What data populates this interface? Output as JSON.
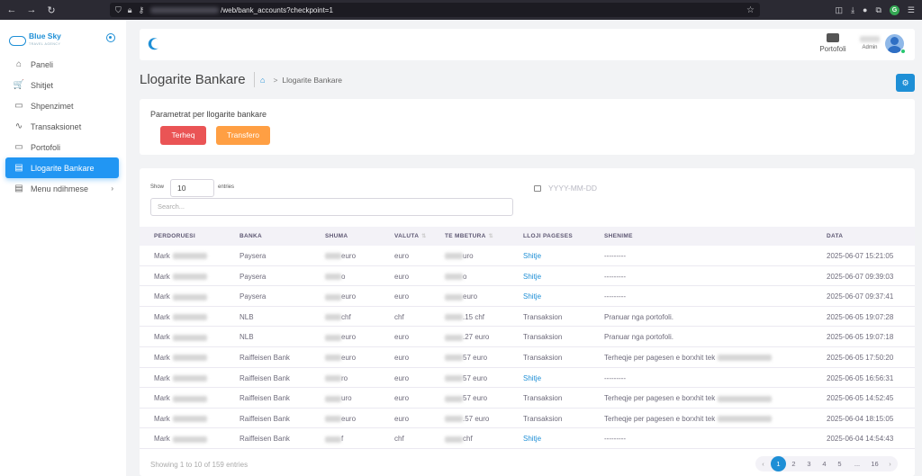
{
  "browser": {
    "url_suffix": "/web/bank_accounts?checkpoint=1",
    "nav": {
      "back": "←",
      "forward": "→",
      "reload": "↻"
    },
    "icons": [
      "shield-icon",
      "lock-icon",
      "key-icon",
      "pocket-icon",
      "download-icon",
      "extension-icon",
      "puzzle-icon",
      "grammarly-icon"
    ]
  },
  "brand": {
    "name": "Blue Sky",
    "tagline": "TRAVEL AGENCY",
    "color": "#1e8fd6"
  },
  "sidebar": {
    "items": [
      {
        "label": "Paneli",
        "icon": "home-icon",
        "glyph": "⌂"
      },
      {
        "label": "Shitjet",
        "icon": "cart-icon",
        "glyph": "🛒"
      },
      {
        "label": "Shpenzimet",
        "icon": "bag-icon",
        "glyph": "▭"
      },
      {
        "label": "Transaksionet",
        "icon": "activity-icon",
        "glyph": "∿"
      },
      {
        "label": "Portofoli",
        "icon": "wallet-icon",
        "glyph": "▭"
      },
      {
        "label": "Llogarite Bankare",
        "icon": "inbox-icon",
        "glyph": "▤",
        "active": true
      },
      {
        "label": "Menu ndihmese",
        "icon": "file-icon",
        "glyph": "▤",
        "chevron": "›"
      }
    ]
  },
  "header": {
    "wallet_label": "Portofoli",
    "user_role": "Admin"
  },
  "page": {
    "title": "Llogarite Bankare",
    "breadcrumb_current": "Llogarite Bankare",
    "breadcrumb_sep": ">"
  },
  "params": {
    "title": "Parametrat per llogarite bankare",
    "withdraw_label": "Terheq",
    "transfer_label": "Transfero"
  },
  "table": {
    "show_label": "Show",
    "entries_value": "10",
    "entries_label": "entries",
    "search_placeholder": "Search...",
    "date_placeholder": "YYYY-MM-DD",
    "columns": [
      "PERDORUESI",
      "BANKA",
      "SHUMA",
      "VALUTA",
      "TE MBETURA",
      "LLOJI PAGESES",
      "SHENIME",
      "DATA"
    ],
    "rows": [
      {
        "user": "Mark",
        "bank": "Paysera",
        "amount_suffix": "euro",
        "currency": "euro",
        "remaining_suffix": "uro",
        "type": "Shitje",
        "type_link": true,
        "note": "---------",
        "note_blur": false,
        "date": "2025-06-07 15:21:05"
      },
      {
        "user": "Mark",
        "bank": "Paysera",
        "amount_suffix": "o",
        "currency": "euro",
        "remaining_suffix": "o",
        "type": "Shitje",
        "type_link": true,
        "note": "---------",
        "note_blur": false,
        "date": "2025-06-07 09:39:03"
      },
      {
        "user": "Mark",
        "bank": "Paysera",
        "amount_suffix": "euro",
        "currency": "euro",
        "remaining_suffix": "euro",
        "type": "Shitje",
        "type_link": true,
        "note": "---------",
        "note_blur": false,
        "date": "2025-06-07 09:37:41"
      },
      {
        "user": "Mark",
        "bank": "NLB",
        "amount_suffix": "chf",
        "currency": "chf",
        "remaining_suffix": ".15 chf",
        "type": "Transaksion",
        "type_link": false,
        "note": "Pranuar nga portofoli.",
        "note_blur": false,
        "date": "2025-06-05 19:07:28"
      },
      {
        "user": "Mark",
        "bank": "NLB",
        "amount_suffix": "euro",
        "currency": "euro",
        "remaining_suffix": ".27 euro",
        "type": "Transaksion",
        "type_link": false,
        "note": "Pranuar nga portofoli.",
        "note_blur": false,
        "date": "2025-06-05 19:07:18"
      },
      {
        "user": "Mark",
        "bank": "Raiffeisen Bank",
        "amount_suffix": "euro",
        "currency": "euro",
        "remaining_suffix": "57 euro",
        "type": "Transaksion",
        "type_link": false,
        "note": "Terheqje per pagesen e borxhit tek",
        "note_blur": true,
        "date": "2025-06-05 17:50:20"
      },
      {
        "user": "Mark",
        "bank": "Raiffeisen Bank",
        "amount_suffix": "ro",
        "currency": "euro",
        "remaining_suffix": "57 euro",
        "type": "Shitje",
        "type_link": true,
        "note": "---------",
        "note_blur": false,
        "date": "2025-06-05 16:56:31"
      },
      {
        "user": "Mark",
        "bank": "Raiffeisen Bank",
        "amount_suffix": "uro",
        "currency": "euro",
        "remaining_suffix": "57 euro",
        "type": "Transaksion",
        "type_link": false,
        "note": "Terheqje per pagesen e borxhit tek",
        "note_blur": true,
        "date": "2025-06-05 14:52:45"
      },
      {
        "user": "Mark",
        "bank": "Raiffeisen Bank",
        "amount_suffix": "euro",
        "currency": "euro",
        "remaining_suffix": ".57 euro",
        "type": "Transaksion",
        "type_link": false,
        "note": "Terheqje per pagesen e borxhit tek",
        "note_blur": true,
        "date": "2025-06-04 18:15:05"
      },
      {
        "user": "Mark",
        "bank": "Raiffeisen Bank",
        "amount_suffix": "f",
        "currency": "chf",
        "remaining_suffix": "chf",
        "type": "Shitje",
        "type_link": true,
        "note": "---------",
        "note_blur": false,
        "date": "2025-06-04 14:54:43"
      }
    ],
    "footer_info": "Showing 1 to 10 of 159 entries",
    "pagination": {
      "prev": "‹",
      "pages": [
        "1",
        "2",
        "3",
        "4",
        "5",
        "...",
        "16"
      ],
      "current": "1",
      "next": "›"
    }
  },
  "colors": {
    "primary": "#1e8fd6",
    "danger": "#ea5455",
    "warning": "#ff9f43",
    "success": "#28c76f"
  }
}
